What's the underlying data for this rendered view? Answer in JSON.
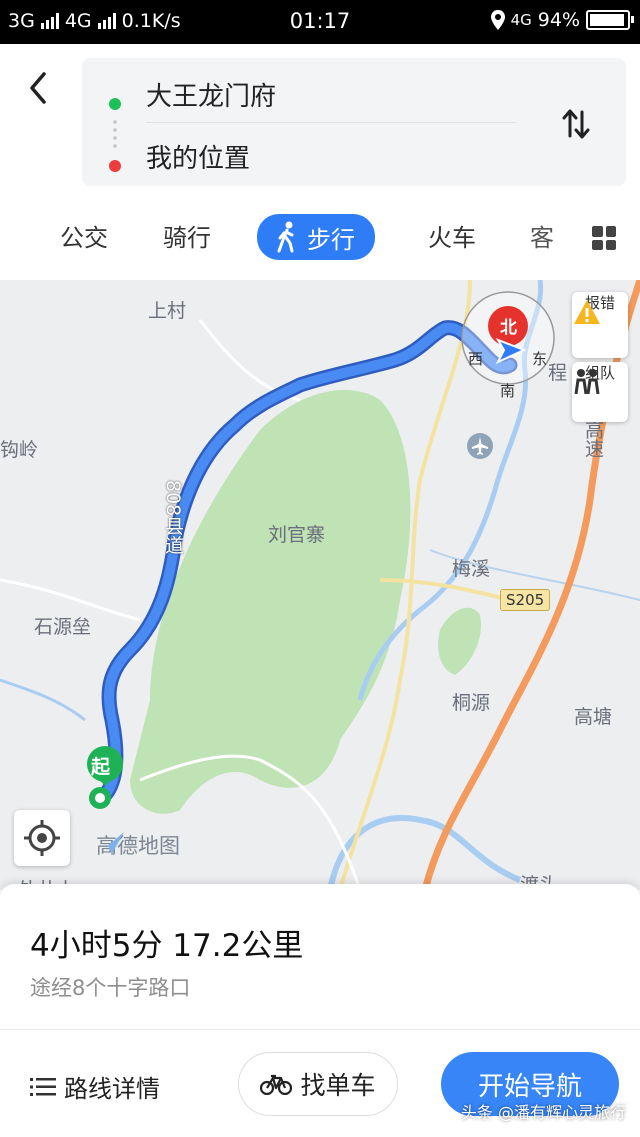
{
  "status_bar": {
    "network1": "3G",
    "network2": "4G",
    "speed": "0.1K/s",
    "time": "01:17",
    "network3": "4G",
    "battery": "94%"
  },
  "route": {
    "origin": "大王龙门府",
    "destination": "我的位置"
  },
  "tabs": [
    {
      "label": "公交"
    },
    {
      "label": "骑行"
    },
    {
      "label": "步行"
    },
    {
      "label": "火车"
    },
    {
      "label": "客"
    }
  ],
  "map": {
    "compass": {
      "north": "北",
      "south": "南",
      "east": "东",
      "west": "西"
    },
    "report_label": "报错",
    "group_label": "组队",
    "labels": {
      "shangcun": "上村",
      "gouling": "钩岭",
      "liuguanzhai": "刘官寨",
      "shiyuanlei": "石源垒",
      "meixi": "梅溪",
      "tongyuan": "桐源",
      "gaotang": "高塘",
      "waijingshui": "外井水",
      "dutou": "渡头",
      "cheng": "程",
      "gaosu": "高速"
    },
    "road_badge": "S205",
    "road_name": "808县道",
    "start_label": "起",
    "logo": "高德地图"
  },
  "summary": {
    "duration_distance": "4小时5分  17.2公里",
    "via": "途经8个十字路口"
  },
  "actions": {
    "details": "路线详情",
    "bike": "找单车",
    "navigate": "开始导航"
  },
  "watermark": "头条 @潘有辉心灵旅行",
  "colors": {
    "accent": "#2f7df6",
    "route": "#3a78e6",
    "green_area": "#bfe3b5"
  }
}
